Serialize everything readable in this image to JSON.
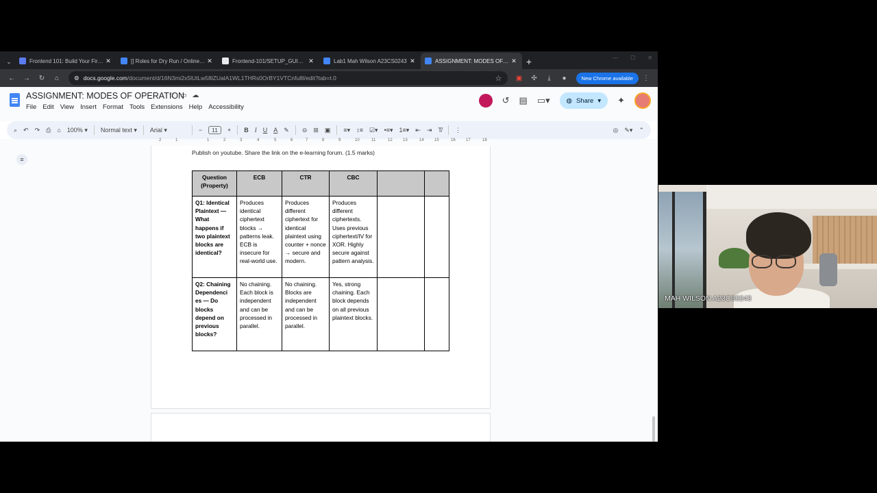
{
  "browser": {
    "tabs": [
      {
        "label": "Frontend 101: Build Your First ...",
        "color": "#5b7cf0",
        "active": false
      },
      {
        "label": "[] Roles for Dry Run / Online V...",
        "color": "#4285f4",
        "active": false
      },
      {
        "label": "Frontend-101/SETUP_GUIDE.m...",
        "color": "#e8eaed",
        "active": false
      },
      {
        "label": "Lab1 Mah Wilson A23CS0243",
        "color": "#4285f4",
        "active": false
      },
      {
        "label": "ASSIGNMENT: MODES OF OPE...",
        "color": "#4285f4",
        "active": true
      }
    ],
    "url_host": "docs.google.com",
    "url_rest": "/document/d/16N3mi2x5lUtLw58lZUalA1WL1THRs0OrBY1VTCnfu8l/edit?tab=t.0",
    "update_label": "New Chrome available"
  },
  "docs": {
    "title": "ASSIGNMENT: MODES OF OPERATION",
    "menu": [
      "File",
      "Edit",
      "View",
      "Insert",
      "Format",
      "Tools",
      "Extensions",
      "Help",
      "Accessibility"
    ],
    "share_label": "Share",
    "toolbar": {
      "zoom": "100%",
      "style": "Normal text",
      "font": "Arial",
      "font_size": "11"
    },
    "ruler": [
      "2",
      "1",
      "1",
      "2",
      "3",
      "4",
      "5",
      "6",
      "7",
      "8",
      "9",
      "10",
      "11",
      "12",
      "13",
      "14",
      "15",
      "16",
      "17",
      "18"
    ],
    "intro_text": "Publish on youtube. Share the link on the e-learning forum. (1.5 marks)",
    "table": {
      "headers": [
        "Question (Property)",
        "ECB",
        "CTR",
        "CBC",
        "",
        ""
      ],
      "rows": [
        [
          "Q1: Identical Plaintext — What happens if two plaintext blocks are identical?",
          "Produces identical ciphertext blocks → patterns leak. ECB is insecure for real-world use.",
          "Produces different ciphertext for identical plaintext using counter + nonce → secure and modern.",
          "Produces different ciphertexts. Uses previous ciphertext/IV for XOR. Highly secure against pattern analysis.",
          "",
          ""
        ],
        [
          "Q2: Chaining Dependenci es — Do blocks depend on previous blocks?",
          "No chaining. Each block is independent and can be processed in parallel.",
          "No chaining. Blocks are independent and can be processed in parallel.",
          "Yes, strong chaining. Each block depends on all previous plaintext blocks.",
          "",
          ""
        ]
      ]
    }
  },
  "video": {
    "participant_name": "MAH WILSON A23CS0243"
  }
}
